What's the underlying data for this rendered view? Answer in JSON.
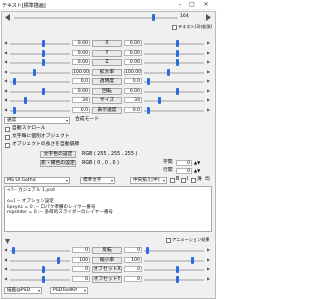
{
  "window": {
    "title": "テキスト[標準描画]",
    "minimize": "–",
    "maximize": "□",
    "close": "✕"
  },
  "timeline": {
    "end_value": "164",
    "play_pos": 0.86
  },
  "top_sliders": [
    {
      "left": "0.00",
      "label": "X",
      "right": "0.00",
      "left_pos": 0.56,
      "right_pos": 0.56
    },
    {
      "left": "0.00",
      "label": "Y",
      "right": "0.00",
      "left_pos": 0.56,
      "right_pos": 0.56
    },
    {
      "left": "0.00",
      "label": "Z",
      "right": "0.00",
      "left_pos": 0.56,
      "right_pos": 0.56
    },
    {
      "left": "100.00",
      "label": "拡大率",
      "right": "100.00",
      "left_pos": 0.4,
      "right_pos": 0.4
    },
    {
      "left": "0.0",
      "label": "透明度",
      "right": "0.0",
      "left_pos": 0.05,
      "right_pos": 0.05
    },
    {
      "left": "0.00",
      "label": "回転",
      "right": "0.00",
      "left_pos": 0.56,
      "right_pos": 0.56
    },
    {
      "left": "34",
      "label": "サイズ",
      "right": "34",
      "left_pos": 0.24,
      "right_pos": 0.24
    },
    {
      "left": "0.0",
      "label": "表示速度",
      "right": "0.0",
      "left_pos": 0.05,
      "right_pos": 0.05
    }
  ],
  "top_right_check": "テキスト(3)(拡張)",
  "blend": {
    "value": "通常",
    "label": "合成モード"
  },
  "checks": [
    {
      "label": "自動スクロール",
      "checked": false
    },
    {
      "label": "文字毎に個別オブジェクト",
      "checked": false
    },
    {
      "label": "オブジェクトの長さを自動調節",
      "checked": false
    }
  ],
  "text_color": {
    "button": "文字色の設定",
    "rgb": "RGB ( 255 , 255 , 255 )"
  },
  "shadow_color": {
    "button": "影・縁色の設定",
    "rgb": "RGB ( 0 , 0 , 0 )"
  },
  "spacing": {
    "char_label": "字間",
    "char_value": "0",
    "line_label": "行間",
    "line_value": "0"
  },
  "font_row": {
    "font": "MS UI Gothic",
    "style": "標準文字",
    "align": "中央揃え[中]",
    "bold": "B",
    "italic": "I",
    "smooth": "滑",
    "smooth_label": "均"
  },
  "text_content": [
    "<?-- カジュアル 1.psd",
    "",
    "o=[ -- オプション設定",
    "lipsync = 0    ;-- 口パク準備のレイヤー番号",
    "mpslider = 0    ;-- 多目的スライダーのレイヤー番号"
  ],
  "bottom_sliders": [
    {
      "left": "0",
      "label": "反転",
      "right": "0",
      "left_pos": 0.03,
      "right_pos": 0.03
    },
    {
      "left": "100",
      "label": "縮小率",
      "right": "100",
      "left_pos": 0.82,
      "right_pos": 0.82
    },
    {
      "left": "0",
      "label": "オフセットX",
      "right": "0",
      "left_pos": 0.56,
      "right_pos": 0.56
    },
    {
      "left": "0",
      "label": "オフセットY",
      "right": "0",
      "left_pos": 0.56,
      "right_pos": 0.56
    }
  ],
  "anim_effect_check": "アニメーション効果",
  "footer": {
    "left_select": "描画@PSD",
    "right_select": "PSDToolKit"
  },
  "colors": {
    "accent": "#2f6ad8",
    "thumb": "#2d6cdf"
  }
}
